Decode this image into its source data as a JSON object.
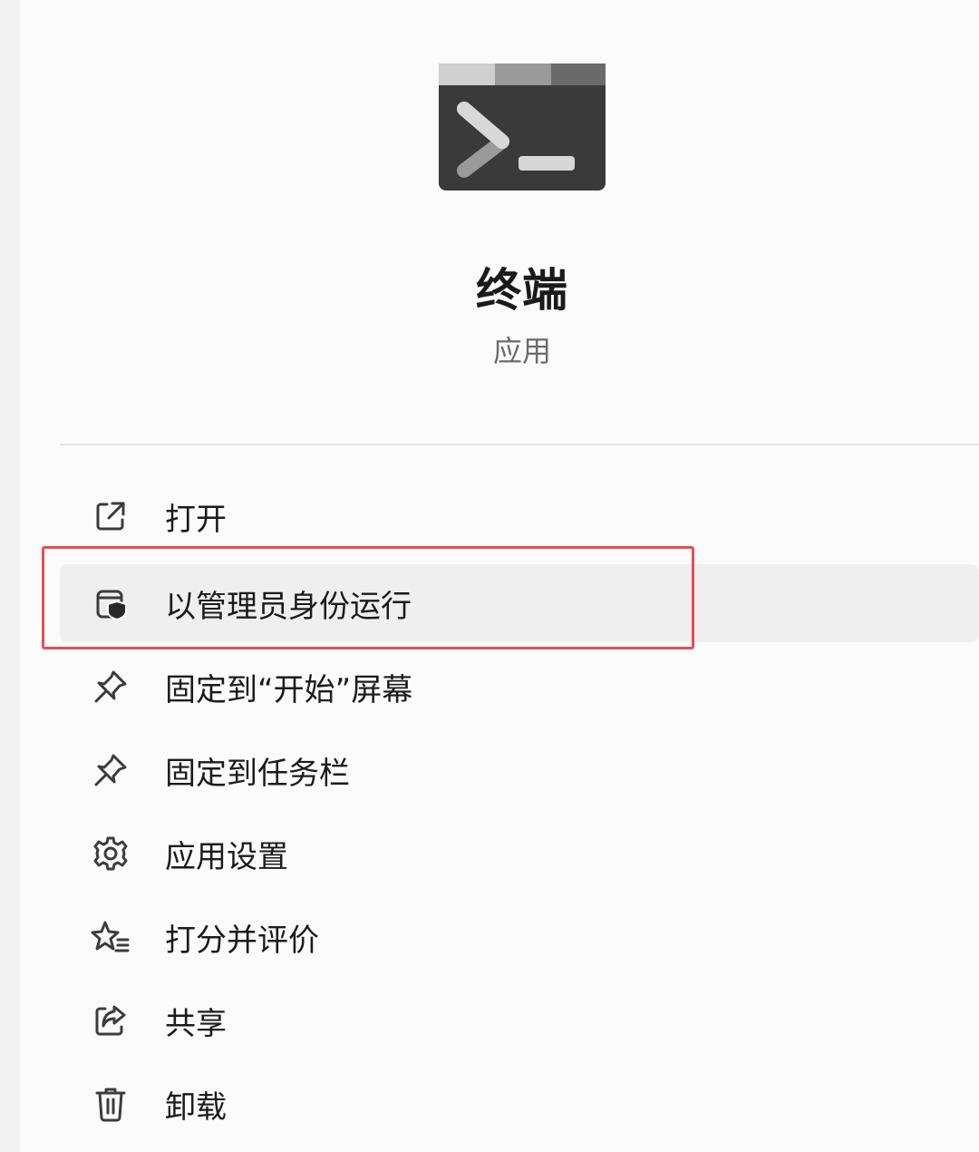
{
  "app": {
    "title": "终端",
    "subtitle": "应用",
    "icon": "terminal-app-icon"
  },
  "menu": {
    "items": [
      {
        "label": "打开",
        "icon": "open-external-icon"
      },
      {
        "label": "以管理员身份运行",
        "icon": "run-as-admin-shield-icon",
        "hovered": true,
        "highlighted": true
      },
      {
        "label": "固定到“开始”屏幕",
        "icon": "pin-icon"
      },
      {
        "label": "固定到任务栏",
        "icon": "pin-icon"
      },
      {
        "label": "应用设置",
        "icon": "gear-icon"
      },
      {
        "label": "打分并评价",
        "icon": "star-rating-icon"
      },
      {
        "label": "共享",
        "icon": "share-icon"
      },
      {
        "label": "卸载",
        "icon": "trash-icon"
      }
    ]
  },
  "colors": {
    "highlight_border": "#e74c57",
    "hover_background": "#efefef",
    "icon_dark": "#3c3c3c"
  }
}
